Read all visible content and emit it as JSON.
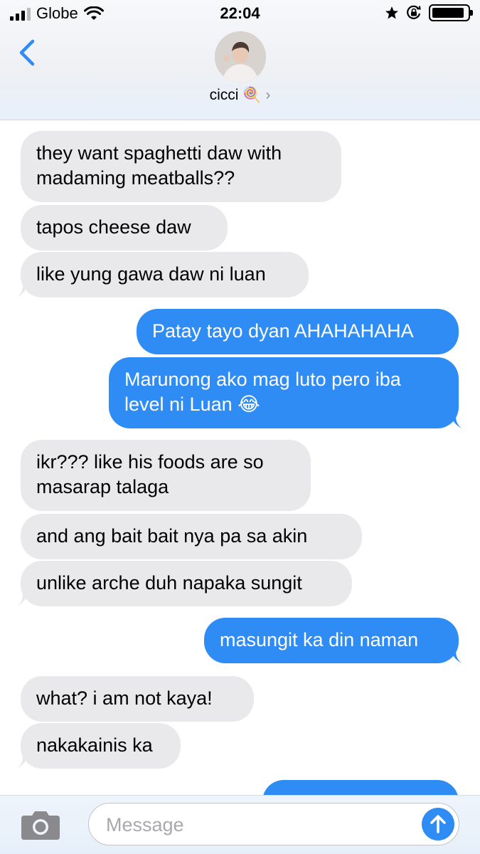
{
  "status_bar": {
    "carrier": "Globe",
    "time": "22:04"
  },
  "contact": {
    "name": "cicci 🍭",
    "chevron": "›"
  },
  "messages": [
    {
      "from": "them",
      "text": "they want spaghetti daw with\nmadaming meatballs??"
    },
    {
      "from": "them",
      "text": "tapos cheese daw"
    },
    {
      "from": "them",
      "text": "like yung gawa daw ni luan"
    },
    {
      "from": "me",
      "text": "Patay tayo dyan AHAHAHAHA"
    },
    {
      "from": "me",
      "text": "Marunong ako mag luto pero iba\nlevel ni Luan 😂"
    },
    {
      "from": "them",
      "text": "ikr??? like his foods are so\nmasarap talaga"
    },
    {
      "from": "them",
      "text": "and ang bait bait nya pa sa akin"
    },
    {
      "from": "them",
      "text": "unlike arche duh napaka sungit"
    },
    {
      "from": "me",
      "text": "masungit ka din naman"
    },
    {
      "from": "them",
      "text": "what? i am not kaya!"
    },
    {
      "from": "them",
      "text": "nakakainis ka"
    },
    {
      "from": "me",
      "text": ""
    }
  ],
  "composer": {
    "placeholder": "Message"
  },
  "colors": {
    "outgoing": "#2f8cf5",
    "incoming": "#e9e9eb",
    "accent": "#2f8cf5"
  },
  "icons": [
    "signal-icon",
    "wifi-icon",
    "star-icon",
    "orientation-lock-icon",
    "battery-icon",
    "back-chevron-icon",
    "camera-icon",
    "send-arrow-icon"
  ]
}
